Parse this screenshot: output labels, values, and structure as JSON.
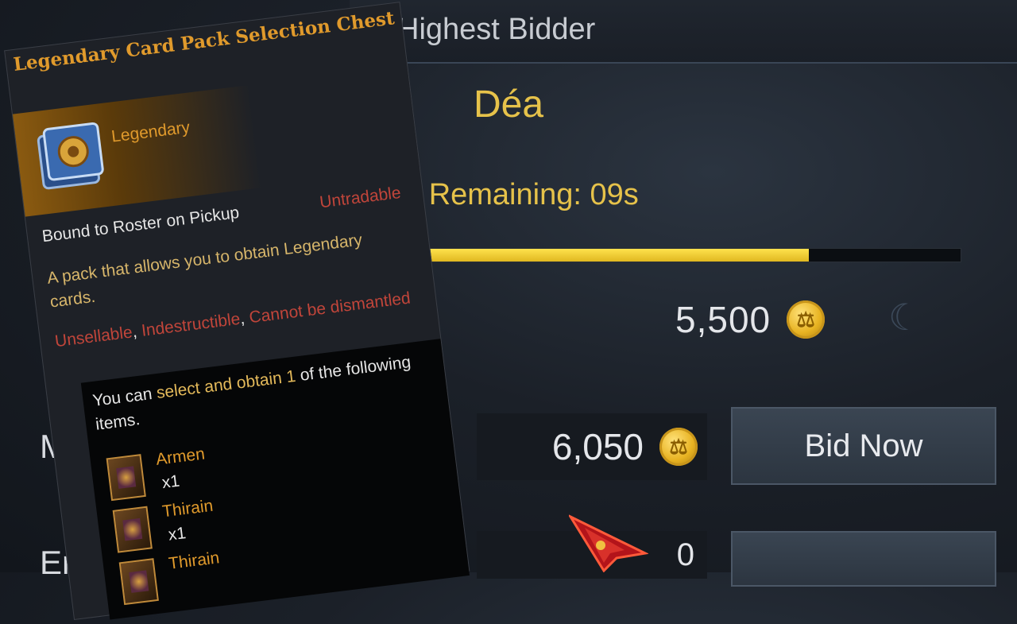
{
  "auction": {
    "header_title": "Highest Bidder",
    "bidder_name": "Déa",
    "time_remaining": "e Remaining: 09s",
    "timer_progress": 0.73,
    "current_price": "5,500",
    "min_label": "M",
    "min_bid": "6,050",
    "bid_button_label": "Bid Now",
    "enter_label": "Ent",
    "enter_value": "0",
    "coin_color": "#e8b322",
    "accent_color": "#e6c24a"
  },
  "tooltip": {
    "title": "Legendary Card Pack Selection Chest",
    "grade": "Legendary",
    "bound": "Bound to Roster on Pickup",
    "tradable": "Untradable",
    "description": "A pack that allows you to obtain Legendary cards.",
    "flags": [
      "Unsellable",
      "Indestructible",
      "Cannot be dismantled"
    ],
    "select_prefix": "You can ",
    "select_highlight": "select and obtain 1",
    "select_suffix": " of the following items.",
    "items": [
      {
        "name": "Armen",
        "qty": "x1"
      },
      {
        "name": "Thirain",
        "qty": "x1"
      },
      {
        "name": "Thirain",
        "qty": ""
      }
    ],
    "grade_color": "#e09a2c",
    "warning_color": "#c0453a"
  }
}
